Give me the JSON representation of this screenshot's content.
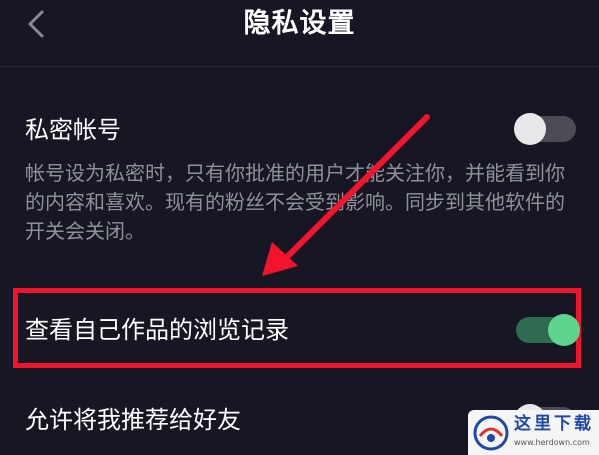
{
  "header": {
    "title": "隐私设置",
    "back_icon": "chevron-left-icon"
  },
  "settings": {
    "private_account": {
      "label": "私密帐号",
      "description": "帐号设为私密时，只有你批准的用户才能关注你，并能看到你的内容和喜欢。现有的粉丝不会受到影响。同步到其他软件的开关会关闭。",
      "enabled": false
    },
    "view_history": {
      "label": "查看自己作品的浏览记录",
      "enabled": true
    },
    "recommend_to_friends": {
      "label": "允许将我推荐给好友",
      "enabled": false
    }
  },
  "annotation": {
    "highlight_color": "#f2142d"
  },
  "colors": {
    "background": "#161722",
    "toggle_on_track": "#2e6a4f",
    "toggle_on_knob": "#5ed48f",
    "toggle_off_track": "#4a4b55",
    "toggle_off_knob": "#e8e8ea",
    "description_text": "#8f909a"
  },
  "watermark": {
    "name": "这里下载",
    "url": "www.herdown.com"
  }
}
